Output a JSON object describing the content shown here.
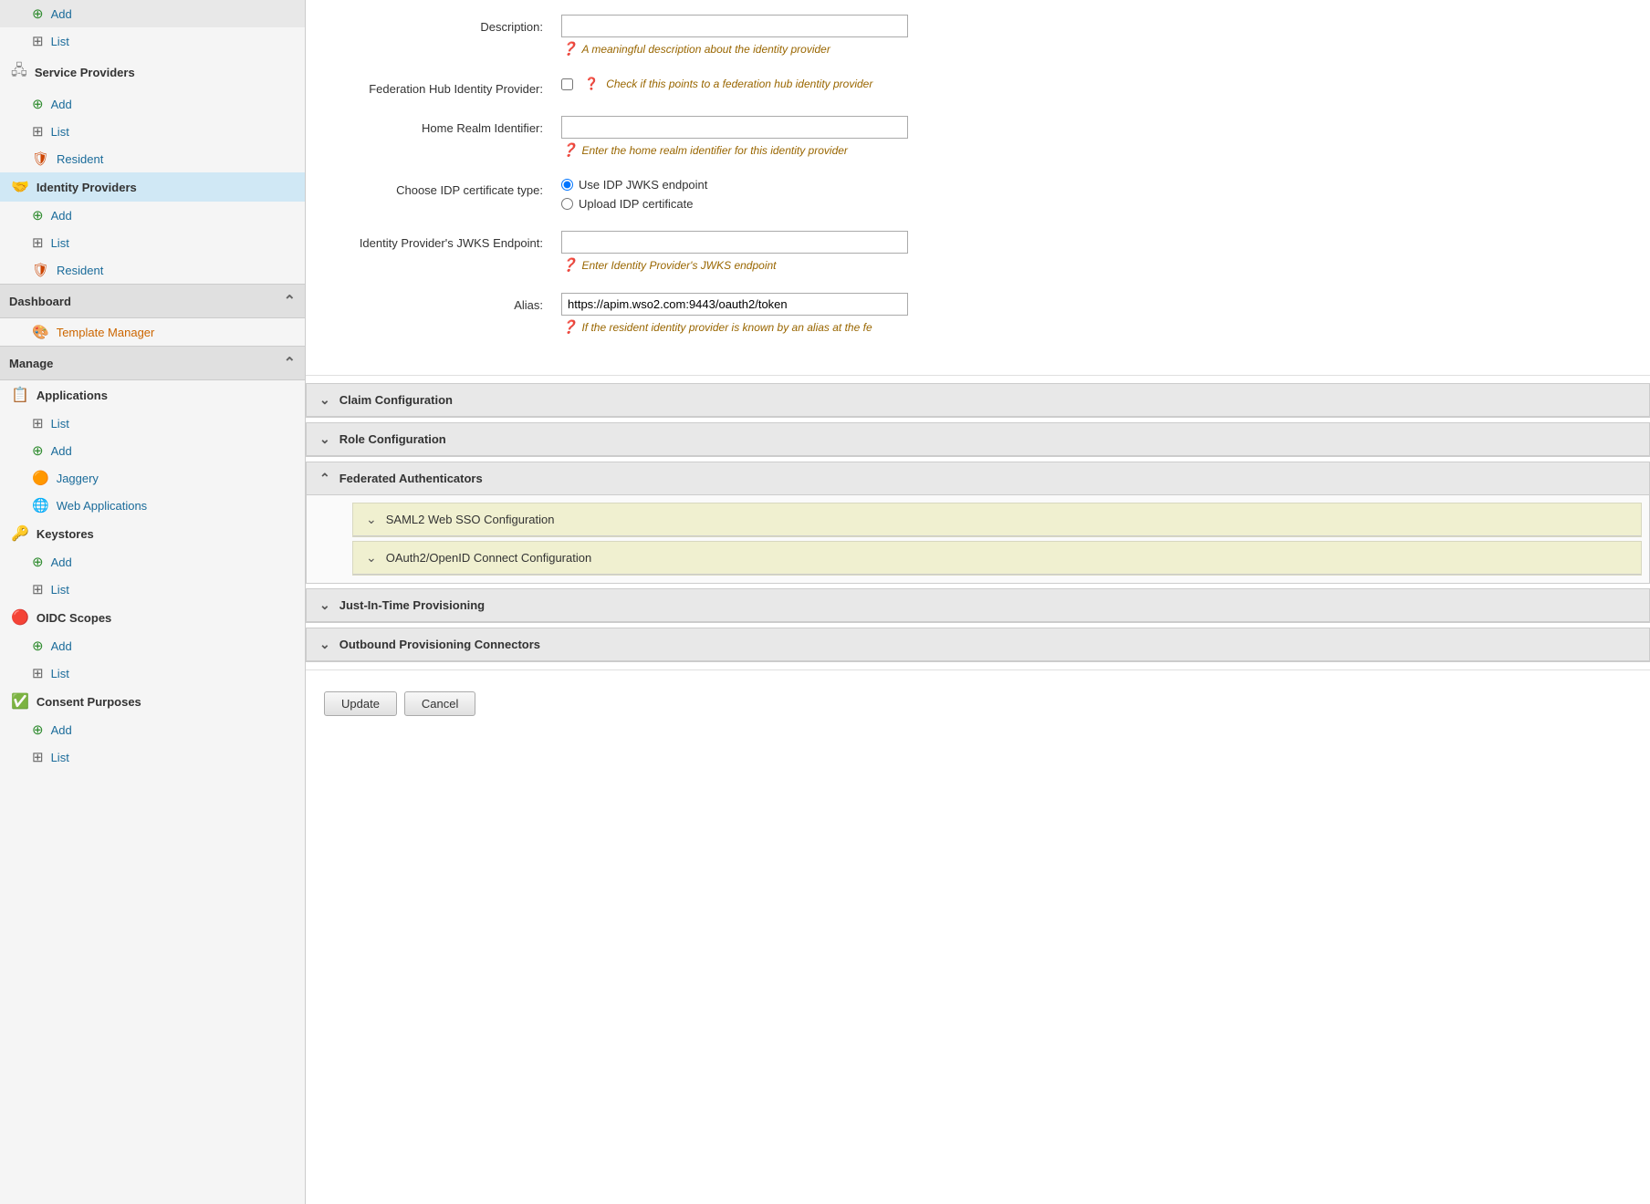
{
  "sidebar": {
    "service_providers": {
      "title": "Service Providers",
      "add_label": "Add",
      "list_label": "List",
      "resident_label": "Resident"
    },
    "identity_providers": {
      "title": "Identity Providers",
      "add_label": "Add",
      "list_label": "List",
      "resident_label": "Resident"
    },
    "dashboard": {
      "title": "Dashboard",
      "template_manager_label": "Template Manager"
    },
    "manage": {
      "title": "Manage",
      "applications": {
        "title": "Applications",
        "list_label": "List",
        "add_label": "Add",
        "jaggery_label": "Jaggery",
        "web_applications_label": "Web Applications"
      },
      "keystores": {
        "title": "Keystores",
        "add_label": "Add",
        "list_label": "List"
      },
      "oidc_scopes": {
        "title": "OIDC Scopes",
        "add_label": "Add",
        "list_label": "List"
      },
      "consent_purposes": {
        "title": "Consent Purposes",
        "add_label": "Add",
        "list_label": "List"
      }
    }
  },
  "form": {
    "description_label": "Description:",
    "description_placeholder": "",
    "description_hint": "A meaningful description about the identity provider",
    "federation_hub_label": "Federation Hub Identity Provider:",
    "federation_hub_hint": "Check if this points to a federation hub identity provider",
    "home_realm_label": "Home Realm Identifier:",
    "home_realm_placeholder": "",
    "home_realm_hint": "Enter the home realm identifier for this identity provider",
    "idp_cert_type_label": "Choose IDP certificate type:",
    "idp_cert_option1": "Use IDP JWKS endpoint",
    "idp_cert_option2": "Upload IDP certificate",
    "jwks_endpoint_label": "Identity Provider's JWKS Endpoint:",
    "jwks_endpoint_placeholder": "",
    "jwks_endpoint_hint": "Enter Identity Provider's JWKS endpoint",
    "alias_label": "Alias:",
    "alias_value": "https://apim.wso2.com:9443/oauth2/token",
    "alias_hint": "If the resident identity provider is known by an alias at the fe"
  },
  "accordions": {
    "claim_configuration": "Claim Configuration",
    "role_configuration": "Role Configuration",
    "federated_authenticators": "Federated Authenticators",
    "saml2_web_sso": "SAML2 Web SSO Configuration",
    "oauth2_openid": "OAuth2/OpenID Connect Configuration",
    "just_in_time": "Just-In-Time Provisioning",
    "outbound_provisioning": "Outbound Provisioning Connectors"
  },
  "buttons": {
    "update_label": "Update",
    "cancel_label": "Cancel"
  }
}
